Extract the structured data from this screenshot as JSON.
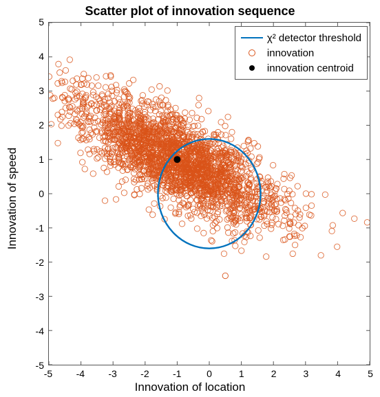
{
  "chart_data": {
    "type": "scatter",
    "title": "Scatter plot of innovation sequence",
    "xlabel": "Innovation of location",
    "ylabel": "Innovation of speed",
    "xlim": [
      -5,
      5
    ],
    "ylim": [
      -5,
      5
    ],
    "xticks": [
      -5,
      -4,
      -3,
      -2,
      -1,
      0,
      1,
      2,
      3,
      4,
      5
    ],
    "yticks": [
      -5,
      -4,
      -3,
      -2,
      -1,
      0,
      1,
      2,
      3,
      4,
      5
    ],
    "legend": {
      "entries": [
        {
          "label": "χ² detector threshold",
          "type": "line",
          "color": "#0072BD"
        },
        {
          "label": "innovation",
          "type": "open-circle",
          "color": "#D95319"
        },
        {
          "label": "innovation centroid",
          "type": "filled-circle",
          "color": "#000000"
        }
      ],
      "position": "top-right"
    },
    "series": [
      {
        "name": "threshold",
        "type": "circle-curve",
        "color": "#0072BD",
        "center": [
          0,
          0
        ],
        "radius": 1.6
      },
      {
        "name": "innovation",
        "type": "open-circle",
        "color": "#D95319",
        "distribution": {
          "kind": "bivariate-normal-approx",
          "mean": [
            -1.0,
            1.0
          ],
          "cov": [
            [
              2.5,
              -1.1
            ],
            [
              -1.1,
              0.9
            ]
          ],
          "n_estimated": 2500,
          "note": "Visual cloud spans roughly x∈[-5,3], y∈[-1.2,3]; one outlier near (0.5,-2.4)."
        },
        "outliers": [
          [
            0.5,
            -2.4
          ]
        ]
      },
      {
        "name": "innovation centroid",
        "type": "filled-circle",
        "color": "#000000",
        "point": [
          -1.0,
          1.0
        ]
      }
    ]
  }
}
